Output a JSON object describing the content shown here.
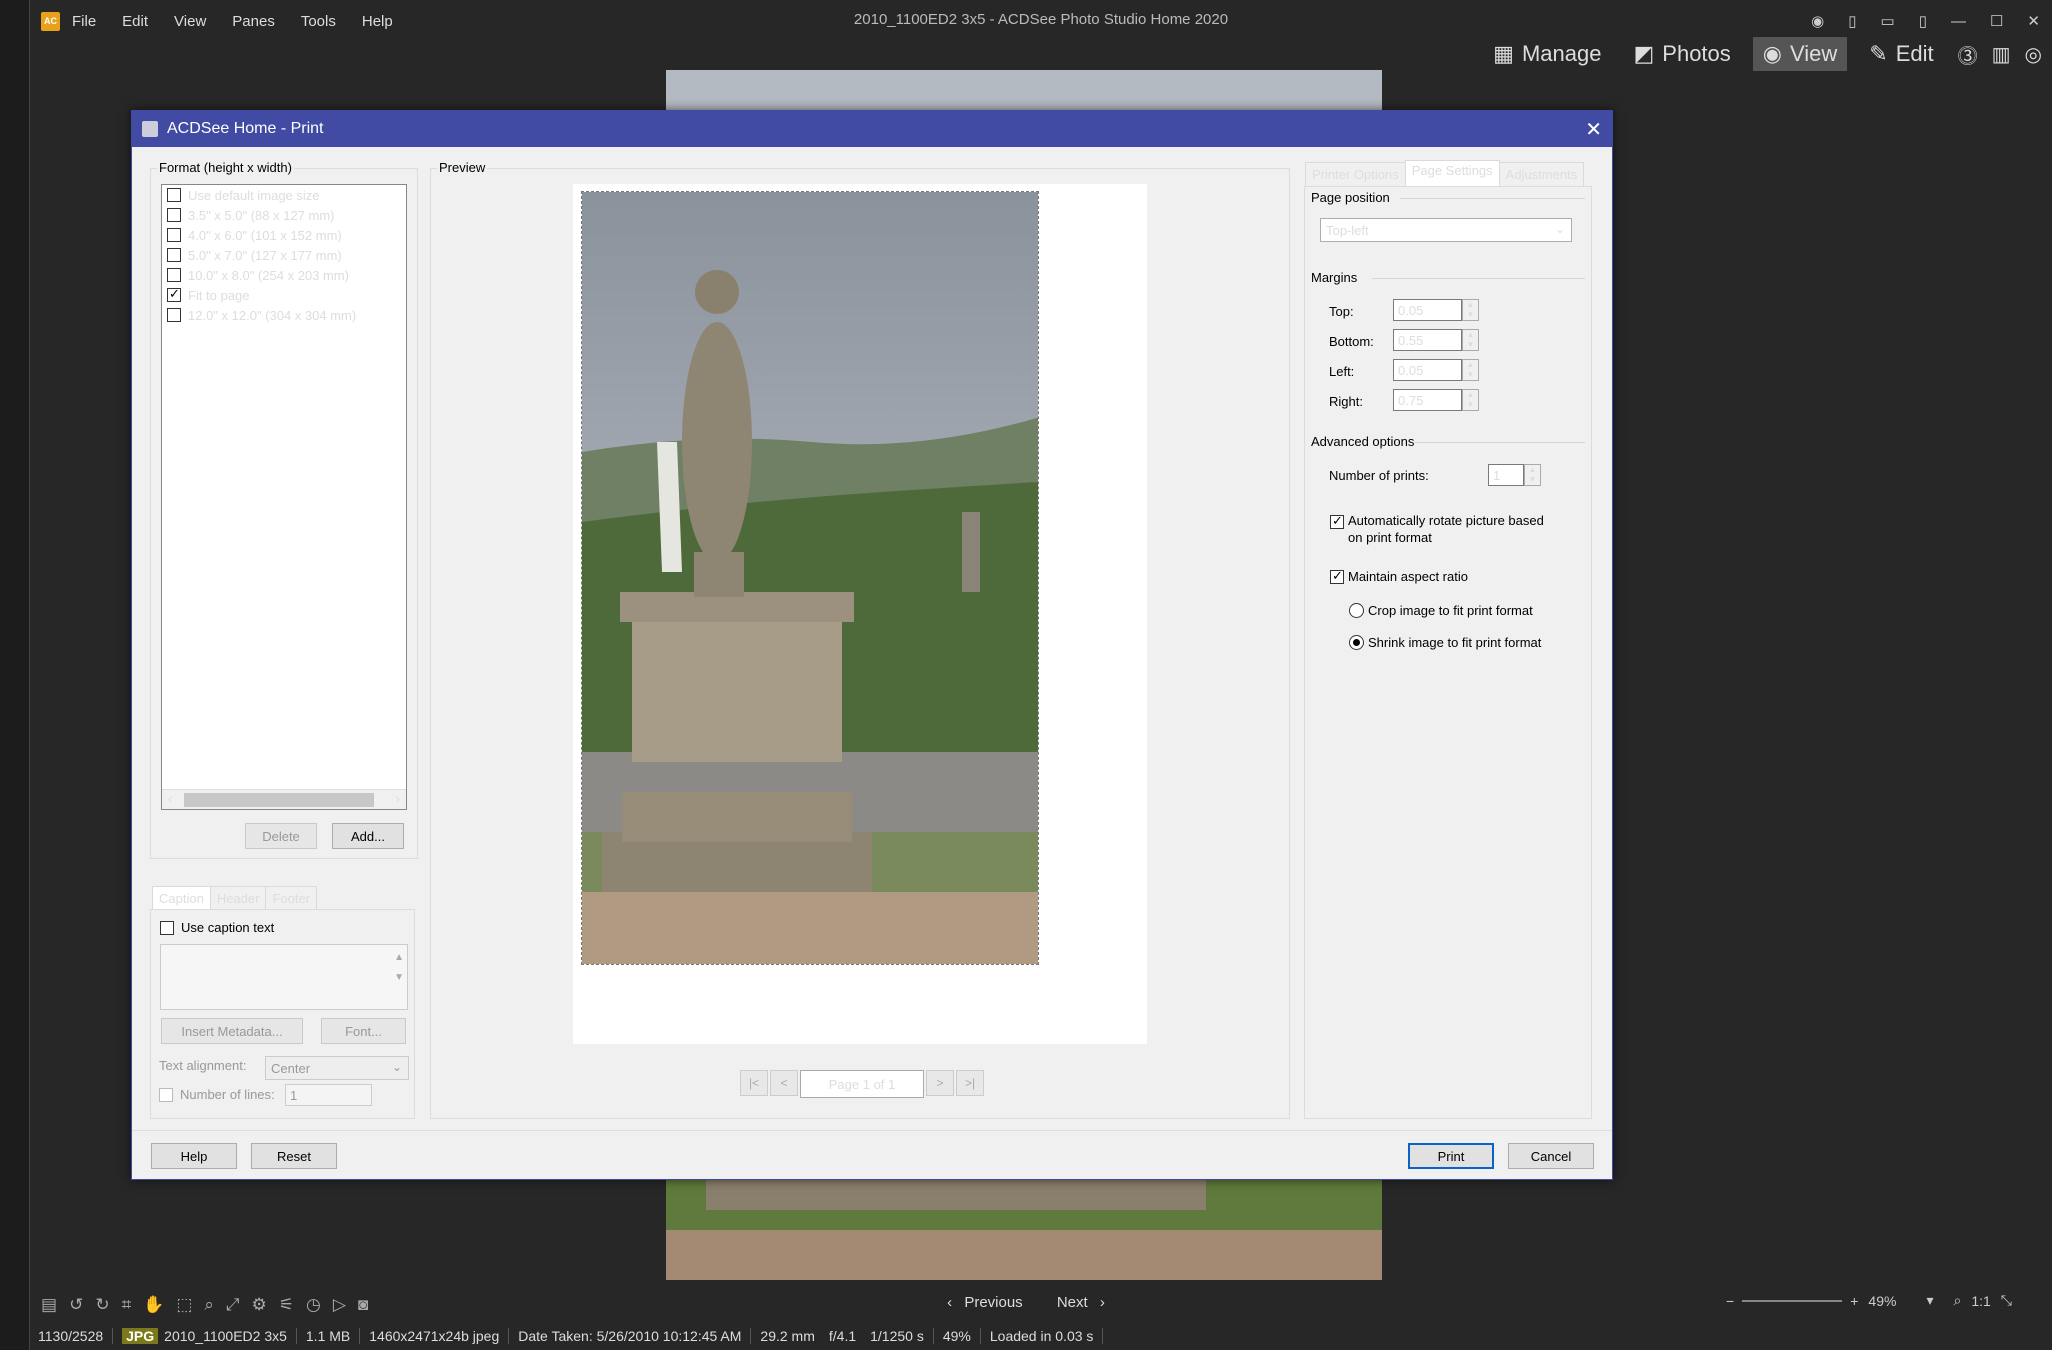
{
  "app": {
    "window_title": "2010_1100ED2 3x5 - ACDSee Photo Studio Home 2020",
    "menu": [
      "File",
      "Edit",
      "View",
      "Panes",
      "Tools",
      "Help"
    ],
    "modes": [
      {
        "label": "Manage",
        "icon": "grid-icon"
      },
      {
        "label": "Photos",
        "icon": "photos-icon"
      },
      {
        "label": "View",
        "icon": "eye-icon",
        "active": true
      },
      {
        "label": "Edit",
        "icon": "edit-icon"
      }
    ]
  },
  "dialog": {
    "title": "ACDSee Home - Print",
    "format": {
      "group_label": "Format (height x width)",
      "items": [
        {
          "label": "Use default image size",
          "checked": false
        },
        {
          "label": "3.5\" x 5.0\" (88 x 127 mm)",
          "checked": false
        },
        {
          "label": "4.0\" x 6.0\" (101 x 152 mm)",
          "checked": false
        },
        {
          "label": "5.0\" x 7.0\" (127 x 177 mm)",
          "checked": false
        },
        {
          "label": "10.0\" x 8.0\" (254 x 203 mm)",
          "checked": false
        },
        {
          "label": "Fit to page",
          "checked": true
        },
        {
          "label": "12.0\" x 12.0\" (304 x 304 mm)",
          "checked": false
        }
      ],
      "delete_label": "Delete",
      "add_label": "Add..."
    },
    "caption": {
      "tabs": [
        "Caption",
        "Header",
        "Footer"
      ],
      "use_caption_label": "Use caption text",
      "insert_metadata_label": "Insert Metadata...",
      "font_label": "Font...",
      "text_alignment_label": "Text alignment:",
      "text_alignment_value": "Center",
      "number_of_lines_label": "Number of lines:",
      "number_of_lines_value": "1"
    },
    "preview": {
      "label": "Preview",
      "page_label": "Page 1 of 1",
      "first": "|<",
      "prev": "<",
      "next": ">",
      "last": ">|"
    },
    "settings": {
      "tabs": [
        "Printer Options",
        "Page Settings",
        "Adjustments"
      ],
      "page_position_label": "Page position",
      "page_position_value": "Top-left",
      "margins_label": "Margins",
      "top_label": "Top:",
      "top_value": "0.05",
      "bottom_label": "Bottom:",
      "bottom_value": "0.55",
      "left_label": "Left:",
      "left_value": "0.05",
      "right_label": "Right:",
      "right_value": "0.75",
      "advanced_label": "Advanced options",
      "number_of_prints_label": "Number of prints:",
      "number_of_prints_value": "1",
      "auto_rotate_label_1": "Automatically rotate picture based",
      "auto_rotate_label_2": "on print format",
      "maintain_aspect_label": "Maintain aspect ratio",
      "crop_label": "Crop image to fit print format",
      "shrink_label": "Shrink image to fit print format"
    },
    "buttons": {
      "help": "Help",
      "reset": "Reset",
      "print": "Print",
      "cancel": "Cancel"
    }
  },
  "navigation": {
    "previous": "Previous",
    "next": "Next"
  },
  "zoom": {
    "value": "49%",
    "one_to_one": "1:1"
  },
  "status": {
    "index": "1130/2528",
    "format": "JPG",
    "filename": "2010_1100ED2 3x5",
    "size": "1.1 MB",
    "dimensions": "1460x2471x24b jpeg",
    "date_taken": "Date Taken: 5/26/2010 10:12:45 AM",
    "focal": "29.2 mm",
    "aperture": "f/4.1",
    "shutter": "1/1250 s",
    "zoom": "49%",
    "loaded": "Loaded in 0.03 s"
  }
}
